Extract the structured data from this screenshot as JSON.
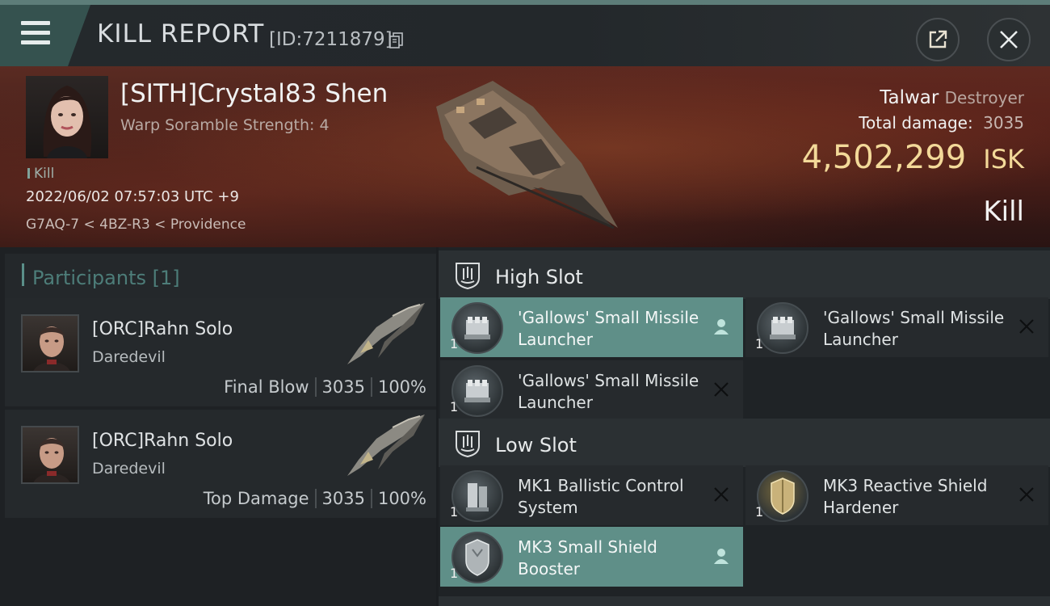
{
  "header": {
    "title": "KILL REPORT",
    "kill_id": "[ID:7211879]"
  },
  "victim": {
    "name": "[SITH]Crystal83 Shen",
    "subtitle": "Warp Soramble Strength: 4",
    "kill_tag": "Kill",
    "time": "2022/06/02 07:57:03 UTC +9",
    "location": "G7AQ-7 < 4BZ-R3 < Providence",
    "ship_name": "Talwar",
    "ship_class": "Destroyer",
    "total_damage_label": "Total damage:",
    "total_damage": "3035",
    "isk_value": "4,502,299",
    "isk_unit": "ISK",
    "result": "Kill"
  },
  "participants": {
    "header": "Participants [1]",
    "cards": [
      {
        "name": "[ORC]Rahn Solo",
        "ship": "Daredevil",
        "role": "Final Blow",
        "damage": "3035",
        "percent": "100%"
      },
      {
        "name": "[ORC]Rahn Solo",
        "ship": "Daredevil",
        "role": "Top Damage",
        "damage": "3035",
        "percent": "100%"
      }
    ]
  },
  "fitting": {
    "high_slot_label": "High Slot",
    "low_slot_label": "Low Slot",
    "high_slots": [
      {
        "name": "'Gallows' Small Missile Launcher",
        "qty": "1",
        "state": "dropped"
      },
      {
        "name": "'Gallows' Small Missile Launcher",
        "qty": "1",
        "state": "destroyed"
      },
      {
        "name": "'Gallows' Small Missile Launcher",
        "qty": "1",
        "state": "destroyed"
      }
    ],
    "low_slots": [
      {
        "name": "MK1 Ballistic Control System",
        "qty": "1",
        "state": "destroyed"
      },
      {
        "name": "MK3 Reactive Shield Hardener",
        "qty": "1",
        "state": "destroyed"
      },
      {
        "name": "MK3 Small Shield Booster",
        "qty": "1",
        "state": "dropped"
      }
    ]
  },
  "colors": {
    "accent_teal": "#5f8f88",
    "isk_gold": "#f3d999",
    "banner_red": "#5a2b22"
  }
}
